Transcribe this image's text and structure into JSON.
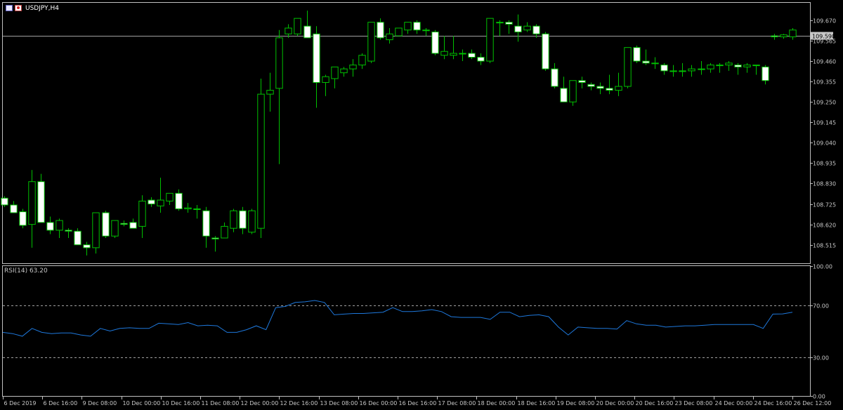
{
  "window": {
    "symbol_title": "USDJPY,H4",
    "rsi_title": "RSI(14) 63.20"
  },
  "colors": {
    "background": "#000000",
    "frame": "#c0c0c0",
    "bull_wick": "#00c000",
    "bull_body": "#000000",
    "bear_body": "#ffffff",
    "bid_line": "#a0a0a0",
    "rsi_line": "#1e78dc",
    "level_line": "#a0a0a0",
    "text": "#c8c8c8"
  },
  "price_box": "109.590",
  "chart_data": [
    {
      "type": "candlestick",
      "title": "USDJPY,H4",
      "ylim": [
        108.42,
        109.76
      ],
      "y_ticks": [
        "109.670",
        "109.565",
        "109.460",
        "109.355",
        "109.250",
        "109.145",
        "109.040",
        "108.935",
        "108.830",
        "108.725",
        "108.620",
        "108.515"
      ],
      "x_ticks": [
        "6 Dec 2019",
        "6 Dec 16:00",
        "9 Dec 08:00",
        "10 Dec 00:00",
        "10 Dec 16:00",
        "11 Dec 08:00",
        "12 Dec 00:00",
        "12 Dec 16:00",
        "13 Dec 08:00",
        "16 Dec 00:00",
        "16 Dec 16:00",
        "17 Dec 08:00",
        "18 Dec 00:00",
        "18 Dec 16:00",
        "19 Dec 08:00",
        "20 Dec 00:00",
        "20 Dec 16:00",
        "23 Dec 08:00",
        "24 Dec 00:00",
        "24 Dec 16:00",
        "26 Dec 12:00"
      ],
      "bid": 109.59,
      "candles": [
        [
          108.755,
          108.765,
          108.71,
          108.72
        ],
        [
          108.72,
          108.74,
          108.68,
          108.68
        ],
        [
          108.685,
          108.7,
          108.6,
          108.615
        ],
        [
          108.62,
          108.9,
          108.5,
          108.84
        ],
        [
          108.84,
          108.88,
          108.65,
          108.63
        ],
        [
          108.63,
          108.66,
          108.57,
          108.59
        ],
        [
          108.59,
          108.65,
          108.55,
          108.64
        ],
        [
          108.59,
          108.6,
          108.55,
          108.585
        ],
        [
          108.585,
          108.6,
          108.52,
          108.515
        ],
        [
          108.515,
          108.53,
          108.46,
          108.5
        ],
        [
          108.5,
          108.68,
          108.47,
          108.68
        ],
        [
          108.68,
          108.69,
          108.55,
          108.56
        ],
        [
          108.56,
          108.64,
          108.55,
          108.64
        ],
        [
          108.625,
          108.64,
          108.61,
          108.62
        ],
        [
          108.63,
          108.65,
          108.6,
          108.6
        ],
        [
          108.61,
          108.77,
          108.55,
          108.74
        ],
        [
          108.745,
          108.76,
          108.71,
          108.725
        ],
        [
          108.715,
          108.86,
          108.68,
          108.745
        ],
        [
          108.74,
          108.78,
          108.72,
          108.78
        ],
        [
          108.78,
          108.8,
          108.69,
          108.7
        ],
        [
          108.7,
          108.73,
          108.68,
          108.705
        ],
        [
          108.7,
          108.72,
          108.65,
          108.7
        ],
        [
          108.69,
          108.71,
          108.5,
          108.56
        ],
        [
          108.55,
          108.56,
          108.48,
          108.545
        ],
        [
          108.55,
          108.63,
          108.55,
          108.61
        ],
        [
          108.6,
          108.7,
          108.58,
          108.69
        ],
        [
          108.69,
          108.71,
          108.57,
          108.6
        ],
        [
          108.58,
          108.7,
          108.57,
          108.69
        ],
        [
          108.6,
          109.37,
          108.55,
          109.29
        ],
        [
          109.29,
          109.4,
          109.2,
          109.31
        ],
        [
          109.32,
          109.62,
          108.93,
          109.58
        ],
        [
          109.6,
          109.65,
          109.58,
          109.63
        ],
        [
          109.6,
          109.68,
          109.59,
          109.68
        ],
        [
          109.64,
          109.72,
          109.58,
          109.58
        ],
        [
          109.6,
          109.64,
          109.22,
          109.35
        ],
        [
          109.35,
          109.39,
          109.28,
          109.38
        ],
        [
          109.37,
          109.42,
          109.32,
          109.43
        ],
        [
          109.4,
          109.43,
          109.38,
          109.42
        ],
        [
          109.42,
          109.47,
          109.38,
          109.44
        ],
        [
          109.44,
          109.5,
          109.42,
          109.49
        ],
        [
          109.46,
          109.57,
          109.45,
          109.66
        ],
        [
          109.66,
          109.68,
          109.57,
          109.58
        ],
        [
          109.57,
          109.63,
          109.55,
          109.6
        ],
        [
          109.59,
          109.62,
          109.6,
          109.63
        ],
        [
          109.62,
          109.66,
          109.6,
          109.66
        ],
        [
          109.66,
          109.67,
          109.6,
          109.62
        ],
        [
          109.62,
          109.63,
          109.59,
          109.62
        ],
        [
          109.61,
          109.62,
          109.49,
          109.5
        ],
        [
          109.49,
          109.59,
          109.47,
          109.51
        ],
        [
          109.49,
          109.59,
          109.47,
          109.5
        ],
        [
          109.5,
          109.52,
          109.46,
          109.5
        ],
        [
          109.5,
          109.52,
          109.47,
          109.48
        ],
        [
          109.48,
          109.5,
          109.44,
          109.46
        ],
        [
          109.46,
          109.68,
          109.45,
          109.68
        ],
        [
          109.66,
          109.67,
          109.59,
          109.66
        ],
        [
          109.66,
          109.67,
          109.6,
          109.65
        ],
        [
          109.64,
          109.7,
          109.56,
          109.61
        ],
        [
          109.62,
          109.66,
          109.61,
          109.64
        ],
        [
          109.64,
          109.65,
          109.58,
          109.6
        ],
        [
          109.6,
          109.61,
          109.41,
          109.42
        ],
        [
          109.42,
          109.45,
          109.32,
          109.33
        ],
        [
          109.32,
          109.38,
          109.25,
          109.25
        ],
        [
          109.25,
          109.34,
          109.23,
          109.36
        ],
        [
          109.36,
          109.38,
          109.32,
          109.35
        ],
        [
          109.34,
          109.35,
          109.31,
          109.33
        ],
        [
          109.33,
          109.35,
          109.29,
          109.32
        ],
        [
          109.32,
          109.39,
          109.29,
          109.31
        ],
        [
          109.31,
          109.4,
          109.28,
          109.33
        ],
        [
          109.33,
          109.52,
          109.32,
          109.53
        ],
        [
          109.53,
          109.54,
          109.45,
          109.46
        ],
        [
          109.46,
          109.52,
          109.44,
          109.45
        ],
        [
          109.45,
          109.48,
          109.42,
          109.45
        ],
        [
          109.44,
          109.45,
          109.39,
          109.41
        ],
        [
          109.41,
          109.44,
          109.38,
          109.41
        ],
        [
          109.41,
          109.45,
          109.38,
          109.41
        ],
        [
          109.41,
          109.44,
          109.38,
          109.42
        ],
        [
          109.42,
          109.46,
          109.39,
          109.42
        ],
        [
          109.42,
          109.45,
          109.4,
          109.44
        ],
        [
          109.44,
          109.45,
          109.4,
          109.44
        ],
        [
          109.44,
          109.46,
          109.41,
          109.45
        ],
        [
          109.44,
          109.45,
          109.39,
          109.43
        ],
        [
          109.43,
          109.45,
          109.4,
          109.44
        ],
        [
          109.44,
          109.44,
          109.39,
          109.44
        ],
        [
          109.43,
          109.44,
          109.34,
          109.36
        ],
        [
          109.59,
          109.6,
          109.57,
          109.585
        ],
        [
          109.585,
          109.6,
          109.575,
          109.595
        ],
        [
          109.585,
          109.63,
          109.57,
          109.62
        ]
      ]
    },
    {
      "type": "line",
      "title": "RSI(14) 63.20",
      "ylim": [
        0,
        100
      ],
      "y_ticks": [
        "100.00",
        "70.00",
        "30.00",
        "0.00"
      ],
      "levels": [
        70,
        30
      ],
      "series": [
        {
          "values": [
            49,
            48,
            46,
            52,
            49,
            48,
            48.5,
            48.5,
            47,
            46,
            52,
            50,
            52,
            52.5,
            52,
            52,
            56,
            55.5,
            55,
            56.5,
            54,
            54.5,
            54,
            49,
            49,
            51,
            54,
            51,
            68,
            69,
            72,
            72.5,
            73.5,
            72,
            62.5,
            63,
            63.5,
            63.5,
            64,
            64.5,
            68,
            65,
            65,
            65.5,
            66.5,
            65,
            61,
            60.5,
            60.5,
            60.5,
            59,
            64.5,
            64.5,
            61,
            62,
            62.5,
            61,
            53,
            47,
            53,
            52.5,
            52,
            52,
            51.5,
            58,
            55.5,
            54.5,
            54.5,
            53,
            53.5,
            54,
            54,
            54.5,
            55,
            55,
            55,
            55,
            55,
            52,
            63,
            63.2,
            64.5
          ]
        }
      ]
    }
  ]
}
